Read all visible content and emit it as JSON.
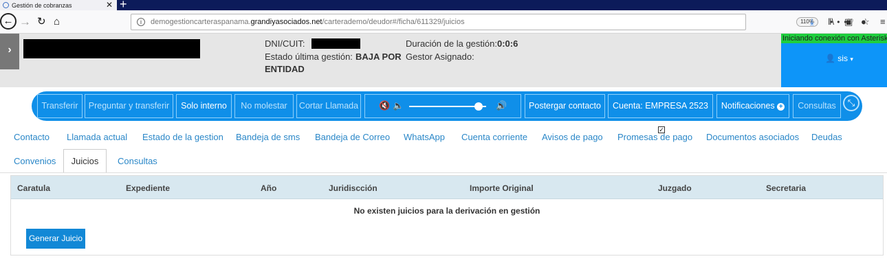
{
  "browser": {
    "tab_title": "Gestión de cobranzas",
    "url_prefix": "demogestioncarteraspanama.",
    "url_domain": "grandiyasociados.net",
    "url_path": "/carterademo/deudor#/ficha/611329/juicios",
    "zoom": "110%"
  },
  "header": {
    "dni_label": "DNI/CUIT:",
    "estado_label": "Estado última gestión:",
    "estado_value_line1": "BAJA POR",
    "estado_value_line2": "ENTIDAD",
    "duracion_label": "Duración de la gestión:",
    "duracion_value": "0:0:6",
    "gestor_label": "Gestor Asignado:",
    "asterisk_status": "Iniciando conexión con Asterisk",
    "user_name": "sis"
  },
  "callbar": {
    "buttons": [
      "Transferir",
      "Preguntar y transferir",
      "Solo interno",
      "No molestar",
      "Cortar Llamada",
      "Postergar contacto",
      "Cuenta: EMPRESA 2523",
      "Notificaciones",
      "Consultas"
    ],
    "volume_level": 0.9
  },
  "tabs": {
    "row1": [
      "Contacto",
      "Llamada actual",
      "Estado de la gestion",
      "Bandeja de sms",
      "Bandeja de Correo",
      "WhatsApp",
      "Cuenta corriente",
      "Avisos de pago",
      "Promesas de pago",
      "Documentos asociados",
      "Deudas"
    ],
    "row2": [
      "Convenios",
      "Juicios",
      "Consultas"
    ],
    "active": "Juicios"
  },
  "table": {
    "columns": [
      "Caratula",
      "Expediente",
      "Año",
      "Juridiscción",
      "Importe Original",
      "Juzgado",
      "Secretaria"
    ],
    "empty_message": "No existen juicios para la derivación en gestión",
    "generate_button": "Generar Juicio"
  },
  "colors": {
    "callbar_bg": "#0f8fe9",
    "asterisk_panel": "#0d95f9",
    "asterisk_status": "#1fce3e",
    "link": "#2a87c8",
    "button_primary": "#1288d6"
  }
}
